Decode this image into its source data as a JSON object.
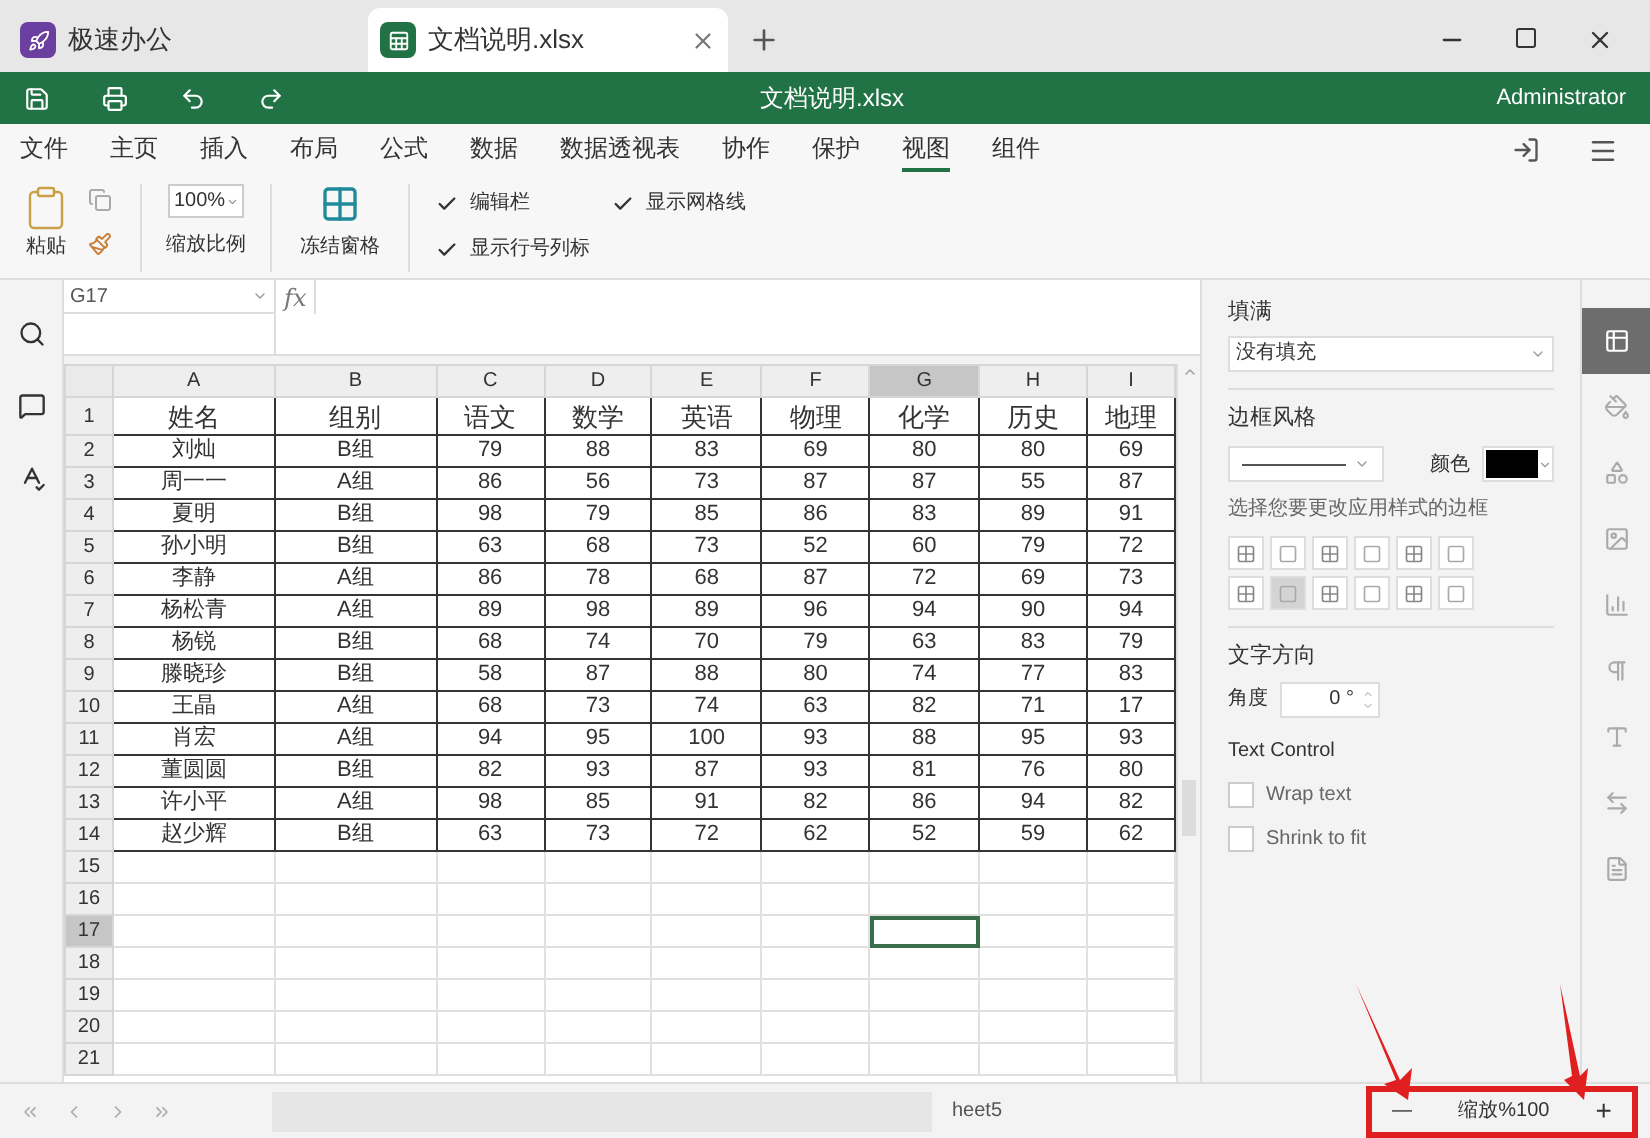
{
  "tabs": [
    {
      "label": "极速办公",
      "kind": "home",
      "selected": false
    },
    {
      "label": "文档说明.xlsx",
      "kind": "sheet",
      "selected": true
    }
  ],
  "title_bar": {
    "title": "文档说明.xlsx",
    "user": "Administrator"
  },
  "menu": [
    {
      "label": "文件",
      "selected": false
    },
    {
      "label": "主页",
      "selected": false
    },
    {
      "label": "插入",
      "selected": false
    },
    {
      "label": "布局",
      "selected": false
    },
    {
      "label": "公式",
      "selected": false
    },
    {
      "label": "数据",
      "selected": false
    },
    {
      "label": "数据透视表",
      "selected": false
    },
    {
      "label": "协作",
      "selected": false
    },
    {
      "label": "保护",
      "selected": false
    },
    {
      "label": "视图",
      "selected": true
    },
    {
      "label": "组件",
      "selected": false
    }
  ],
  "ribbon": {
    "paste": "粘贴",
    "zoom_value": "100%",
    "zoom_label": "缩放比例",
    "freeze": "冻结窗格",
    "checks": [
      {
        "label": "编辑栏",
        "checked": true
      },
      {
        "label": "显示网格线",
        "checked": true
      },
      {
        "label": "显示行号列标",
        "checked": true
      }
    ]
  },
  "formula_bar": {
    "name_box": "G17",
    "fx": "fx"
  },
  "sheet": {
    "columns": [
      {
        "label": "A",
        "selected": false
      },
      {
        "label": "B",
        "selected": false
      },
      {
        "label": "C",
        "selected": false
      },
      {
        "label": "D",
        "selected": false
      },
      {
        "label": "E",
        "selected": false
      },
      {
        "label": "F",
        "selected": false
      },
      {
        "label": "G",
        "selected": true
      },
      {
        "label": "H",
        "selected": false
      },
      {
        "label": "I",
        "selected": false
      }
    ],
    "rows": [
      {
        "label": "1",
        "selected": false,
        "cells": [
          "姓名",
          "组别",
          "语文",
          "数学",
          "英语",
          "物理",
          "化学",
          "历史",
          "地理"
        ]
      },
      {
        "label": "2",
        "selected": false,
        "cells": [
          "刘灿",
          "B组",
          "79",
          "88",
          "83",
          "69",
          "80",
          "80",
          "69"
        ]
      },
      {
        "label": "3",
        "selected": false,
        "cells": [
          "周一一",
          "A组",
          "86",
          "56",
          "73",
          "87",
          "87",
          "55",
          "87"
        ]
      },
      {
        "label": "4",
        "selected": false,
        "cells": [
          "夏明",
          "B组",
          "98",
          "79",
          "85",
          "86",
          "83",
          "89",
          "91"
        ]
      },
      {
        "label": "5",
        "selected": false,
        "cells": [
          "孙小明",
          "B组",
          "63",
          "68",
          "73",
          "52",
          "60",
          "79",
          "72"
        ]
      },
      {
        "label": "6",
        "selected": false,
        "cells": [
          "李静",
          "A组",
          "86",
          "78",
          "68",
          "87",
          "72",
          "69",
          "73"
        ]
      },
      {
        "label": "7",
        "selected": false,
        "cells": [
          "杨松青",
          "A组",
          "89",
          "98",
          "89",
          "96",
          "94",
          "90",
          "94"
        ]
      },
      {
        "label": "8",
        "selected": false,
        "cells": [
          "杨锐",
          "B组",
          "68",
          "74",
          "70",
          "79",
          "63",
          "83",
          "79"
        ]
      },
      {
        "label": "9",
        "selected": false,
        "cells": [
          "滕晓珍",
          "B组",
          "58",
          "87",
          "88",
          "80",
          "74",
          "77",
          "83"
        ]
      },
      {
        "label": "10",
        "selected": false,
        "cells": [
          "王晶",
          "A组",
          "68",
          "73",
          "74",
          "63",
          "82",
          "71",
          "17"
        ]
      },
      {
        "label": "11",
        "selected": false,
        "cells": [
          "肖宏",
          "A组",
          "94",
          "95",
          "100",
          "93",
          "88",
          "95",
          "93"
        ]
      },
      {
        "label": "12",
        "selected": false,
        "cells": [
          "董圆圆",
          "B组",
          "82",
          "93",
          "87",
          "93",
          "81",
          "76",
          "80"
        ]
      },
      {
        "label": "13",
        "selected": false,
        "cells": [
          "许小平",
          "A组",
          "98",
          "85",
          "91",
          "82",
          "86",
          "94",
          "82"
        ]
      },
      {
        "label": "14",
        "selected": false,
        "cells": [
          "赵少辉",
          "B组",
          "63",
          "73",
          "72",
          "62",
          "52",
          "59",
          "62"
        ]
      },
      {
        "label": "15",
        "selected": false,
        "cells": []
      },
      {
        "label": "16",
        "selected": false,
        "cells": []
      },
      {
        "label": "17",
        "selected": true,
        "cells": []
      },
      {
        "label": "18",
        "selected": false,
        "cells": []
      },
      {
        "label": "19",
        "selected": false,
        "cells": []
      },
      {
        "label": "20",
        "selected": false,
        "cells": []
      },
      {
        "label": "21",
        "selected": false,
        "cells": []
      }
    ]
  },
  "format_panel": {
    "fill_label": "填满",
    "fill_value": "没有填充",
    "border_label": "边框风格",
    "color_label": "颜色",
    "border_hint": "选择您要更改应用样式的边框",
    "border_buttons": [
      {
        "selected": false
      },
      {
        "selected": false
      },
      {
        "selected": false
      },
      {
        "selected": false
      },
      {
        "selected": false
      },
      {
        "selected": false
      },
      {
        "selected": false
      },
      {
        "selected": true
      },
      {
        "selected": false
      },
      {
        "selected": false
      },
      {
        "selected": false
      },
      {
        "selected": false
      }
    ],
    "direction_label": "文字方向",
    "angle_label": "角度",
    "angle_value": "0 °",
    "text_control_label": "Text Control",
    "options": [
      {
        "label": "Wrap text",
        "checked": false
      },
      {
        "label": "Shrink to fit",
        "checked": false
      }
    ]
  },
  "side_tabs": [
    {
      "selected": true
    },
    {
      "selected": false
    },
    {
      "selected": false
    },
    {
      "selected": false
    },
    {
      "selected": false
    },
    {
      "selected": false
    },
    {
      "selected": false
    },
    {
      "selected": false
    },
    {
      "selected": false
    }
  ],
  "status_bar": {
    "sheet_tab": "heet5",
    "minus": "—",
    "zoom_text": "缩放%100",
    "plus": "+"
  }
}
